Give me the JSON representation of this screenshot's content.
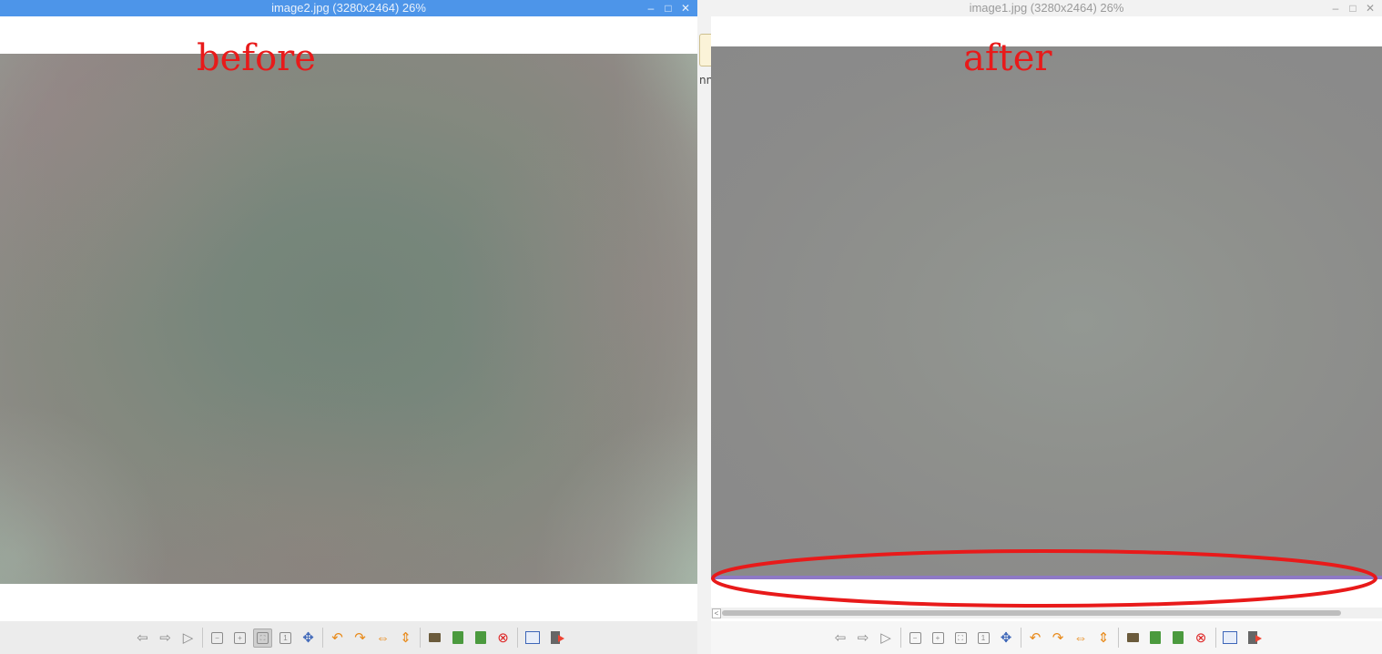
{
  "windows": {
    "left": {
      "title": "image2.jpg (3280x2464) 26%",
      "annotation": "before"
    },
    "right": {
      "title": "image1.jpg (3280x2464) 26%",
      "annotation": "after"
    }
  },
  "title_controls": {
    "minimize": "–",
    "maximize": "□",
    "close": "✕"
  },
  "gap_label": "nn",
  "icons": {
    "back": "⇦",
    "forward": "⇨",
    "play": "▷",
    "zoom_out": "−",
    "zoom_in": "+",
    "fit": "⛶",
    "original": "1",
    "fullscreen": "✥",
    "rotate_left": "↶",
    "rotate_right": "↷",
    "flip_h": "⇔",
    "flip_v": "⇕",
    "close_file": "⊗"
  },
  "toolbar_icon_names": [
    "back-icon",
    "forward-icon",
    "slideshow-icon",
    "zoom-out-icon",
    "zoom-in-icon",
    "zoom-fit-icon",
    "zoom-original-icon",
    "fullscreen-icon",
    "rotate-left-icon",
    "rotate-right-icon",
    "flip-horizontal-icon",
    "flip-vertical-icon",
    "open-file-icon",
    "save-file-icon",
    "delete-file-icon",
    "close-file-icon",
    "preferences-icon",
    "exit-icon"
  ],
  "colors": {
    "active_titlebar": "#4d95e9",
    "annotation_red": "#e81a1a",
    "purple_band": "#8e79c6"
  }
}
